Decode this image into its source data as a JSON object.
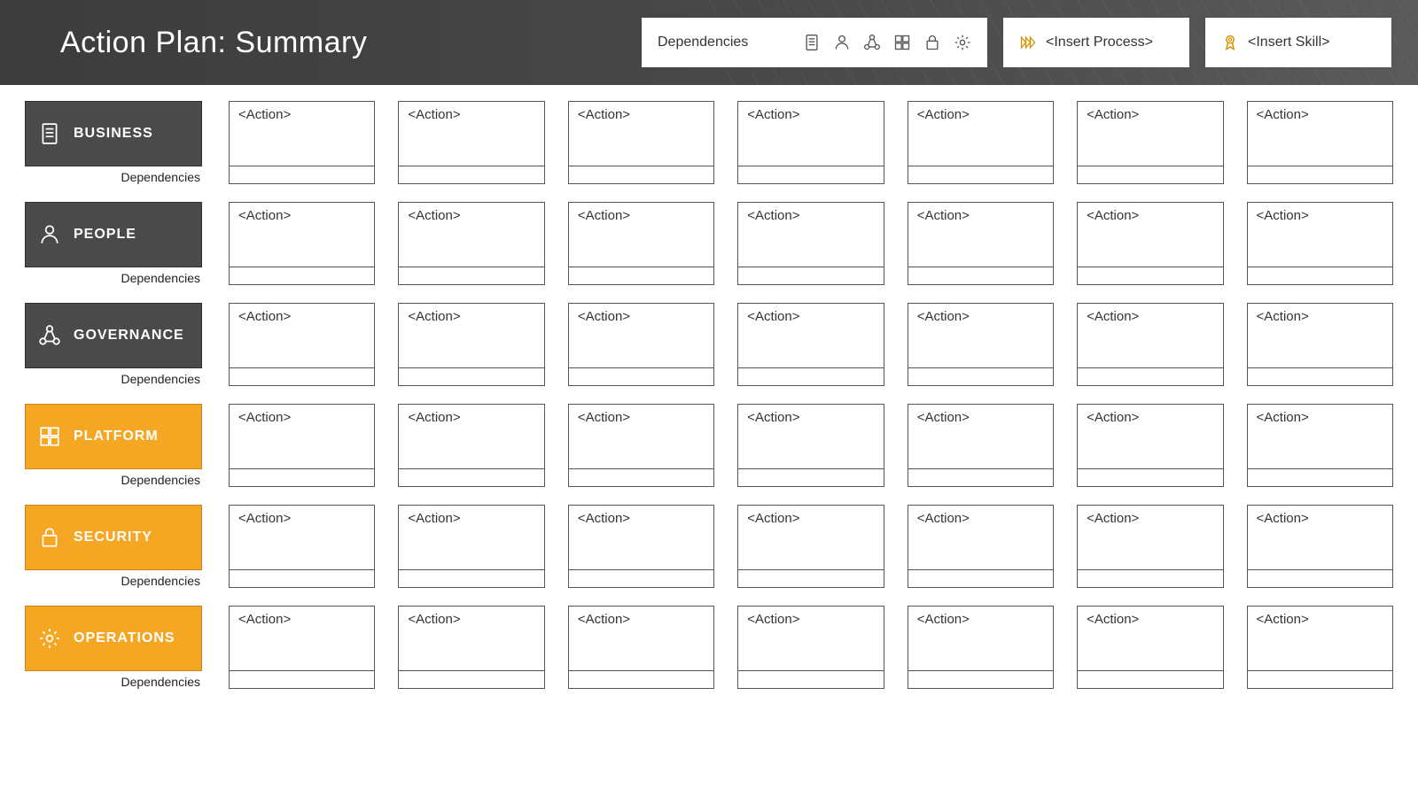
{
  "header": {
    "title": "Action Plan: Summary",
    "dependencies_label": "Dependencies",
    "dependency_icons": [
      "business-icon",
      "people-icon",
      "governance-icon",
      "platform-icon",
      "security-icon",
      "operations-icon"
    ],
    "process_label": "<Insert Process>",
    "skill_label": "<Insert Skill>"
  },
  "colors": {
    "dark": "#4a4a4a",
    "orange": "#f5a623"
  },
  "rows": [
    {
      "id": "business",
      "label": "BUSINESS",
      "theme": "dark",
      "icon": "business-icon",
      "sublabel": "Dependencies",
      "actions": [
        "<Action>",
        "<Action>",
        "<Action>",
        "<Action>",
        "<Action>",
        "<Action>",
        "<Action>"
      ]
    },
    {
      "id": "people",
      "label": "PEOPLE",
      "theme": "dark",
      "icon": "people-icon",
      "sublabel": "Dependencies",
      "actions": [
        "<Action>",
        "<Action>",
        "<Action>",
        "<Action>",
        "<Action>",
        "<Action>",
        "<Action>"
      ]
    },
    {
      "id": "governance",
      "label": "GOVERNANCE",
      "theme": "dark",
      "icon": "governance-icon",
      "sublabel": "Dependencies",
      "actions": [
        "<Action>",
        "<Action>",
        "<Action>",
        "<Action>",
        "<Action>",
        "<Action>",
        "<Action>"
      ]
    },
    {
      "id": "platform",
      "label": "PLATFORM",
      "theme": "orange",
      "icon": "platform-icon",
      "sublabel": "Dependencies",
      "actions": [
        "<Action>",
        "<Action>",
        "<Action>",
        "<Action>",
        "<Action>",
        "<Action>",
        "<Action>"
      ]
    },
    {
      "id": "security",
      "label": "SECURITY",
      "theme": "orange",
      "icon": "security-icon",
      "sublabel": "Dependencies",
      "actions": [
        "<Action>",
        "<Action>",
        "<Action>",
        "<Action>",
        "<Action>",
        "<Action>",
        "<Action>"
      ]
    },
    {
      "id": "operations",
      "label": "OPERATIONS",
      "theme": "orange",
      "icon": "operations-icon",
      "sublabel": "Dependencies",
      "actions": [
        "<Action>",
        "<Action>",
        "<Action>",
        "<Action>",
        "<Action>",
        "<Action>",
        "<Action>"
      ]
    }
  ]
}
